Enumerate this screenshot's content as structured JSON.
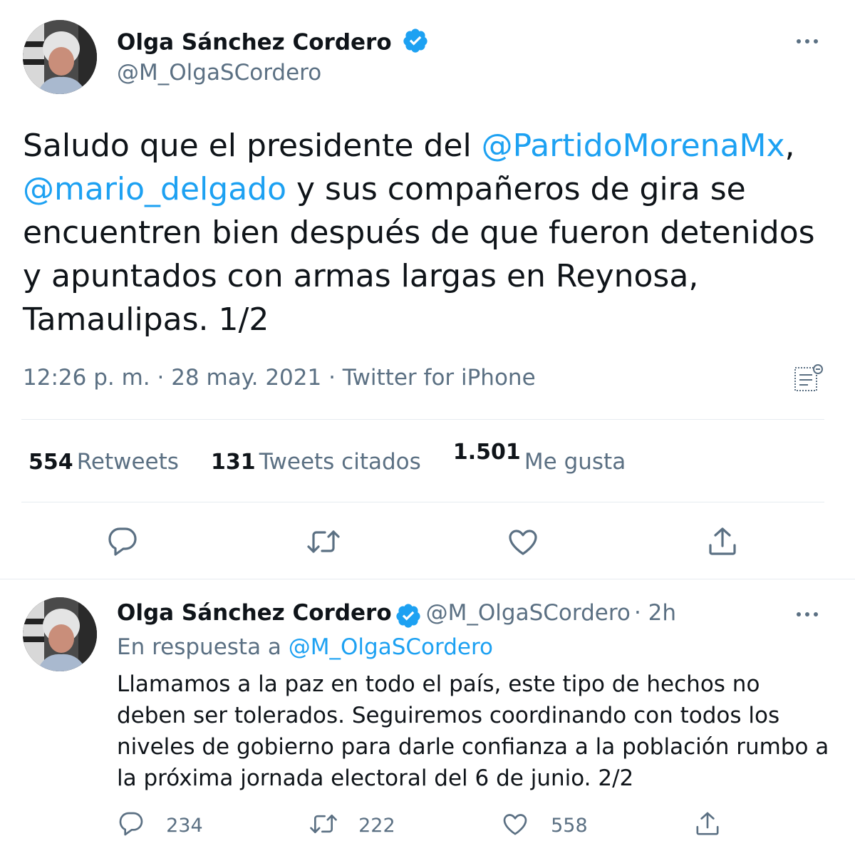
{
  "tweet": {
    "author_name": "Olga Sánchez Cordero",
    "author_handle": "@M_OlgaSCordero",
    "text_before": "Saludo que el presidente del ",
    "mention_1": "@PartidoMorenaMx",
    "text_comma": ",",
    "mention_2": "@mario_delgado",
    "text_after": " y sus compañeros de gira se encuentren bien después de que fueron detenidos y apuntados con armas largas en Reynosa, Tamaulipas. 1/2",
    "meta": "12:26 p. m. · 28 may. 2021 · Twitter for iPhone",
    "stats": {
      "retweets_count": "554",
      "retweets_label": "Retweets",
      "quotes_count": "131",
      "quotes_label": "Tweets citados",
      "likes_count": "1.501",
      "likes_label": "Me gusta"
    }
  },
  "reply": {
    "author_name": "Olga Sánchez Cordero",
    "author_handle": "@M_OlgaSCordero",
    "time": "· 2h",
    "reply_prefix": "En respuesta a ",
    "reply_to": "@M_OlgaSCordero",
    "text": "Llamamos a la paz en todo el país, este tipo de hechos no deben ser tolerados. Seguiremos coordinando con todos los niveles de gobierno para darle confianza a la población rumbo a la próxima jornada electoral del 6 de junio. 2/2",
    "reply_count": "234",
    "retweet_count": "222",
    "like_count": "558"
  },
  "colors": {
    "link": "#1da1f2",
    "secondary": "#5b7083",
    "verified": "#1da1f2",
    "divider": "#e6ecf0"
  },
  "icons": [
    "verified-badge-icon",
    "more-icon",
    "analytics-icon",
    "reply-icon",
    "retweet-icon",
    "like-icon",
    "share-icon"
  ]
}
